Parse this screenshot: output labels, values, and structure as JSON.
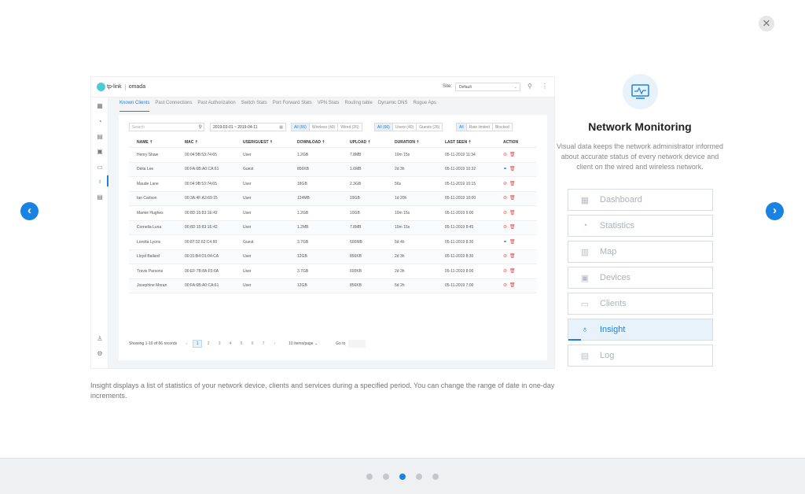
{
  "close_icon": "close-icon",
  "nav": {
    "prev_icon": "chevron-left-icon",
    "next_icon": "chevron-right-icon"
  },
  "screenshot": {
    "logo_brand": "tp-link",
    "logo_product": "omada",
    "site_label": "Site:",
    "site_value": "Default",
    "tabs": [
      "Known Clients",
      "Past Connections",
      "Past Authorization",
      "Switch Stats",
      "Port Forward Stats",
      "VPN Stats",
      "Routing table",
      "Dynamic DNS",
      "Rogue Aps"
    ],
    "search_placeholder": "Search",
    "date_range": "2019-03-01  ~  2019-04-11",
    "filter_conn": [
      "All (66)",
      "Wireless (40)",
      "Wired (26)"
    ],
    "filter_type": [
      "All (66)",
      "Users (40)",
      "Guests (26)"
    ],
    "filter_status": [
      "All",
      "Rate limited",
      "Blocked"
    ],
    "columns": [
      "NAME ⇡",
      "MAC ⇡",
      "USER/GUEST ⇡",
      "DOWNLOAD ⇡",
      "UPLOAD ⇡",
      "DURATION ⇡",
      "LAST SEEN ⇡",
      "ACTION"
    ],
    "rows": [
      {
        "name": "Henry Shaw",
        "mac": "00:04:9B:53:74:65",
        "type": "User",
        "download": "1.2GB",
        "upload": "7.8MB",
        "duration": "10m 15s",
        "last_seen": "05-11-2019 11:34"
      },
      {
        "name": "Delia Lee",
        "mac": "00:FA:6B:A0:CA:61",
        "type": "Guest",
        "download": "856KB",
        "upload": "1.6MB",
        "duration": "2d 3h",
        "last_seen": "05-11-2019 10:32"
      },
      {
        "name": "Maude Lane",
        "mac": "00:04:9B:53:74:65",
        "type": "User",
        "download": "18GB",
        "upload": "2.3GB",
        "duration": "56s",
        "last_seen": "05-11-2019 10:15"
      },
      {
        "name": "Ian Carlson",
        "mac": "00:3A:4F:A2:69:15",
        "type": "User",
        "download": "124MB",
        "upload": "19GB",
        "duration": "1d 20h",
        "last_seen": "05-11-2019 10:00"
      },
      {
        "name": "Mamie Hughes",
        "mac": "00:8D:15:83:1E:42",
        "type": "User",
        "download": "1.2GB",
        "upload": "10GB",
        "duration": "10m 15s",
        "last_seen": "05-11-2019 9:00"
      },
      {
        "name": "Cornelia Luna",
        "mac": "00:8D:15:83:1E:42",
        "type": "User",
        "download": "1.2MB",
        "upload": "7.8MB",
        "duration": "10m 15s",
        "last_seen": "05-11-2019 8:45"
      },
      {
        "name": "Loretta Lyons",
        "mac": "00:87:32:62:C4:60",
        "type": "Guest",
        "download": "3.7GB",
        "upload": "600MB",
        "duration": "5d 4h",
        "last_seen": "05-11-2019 8:30"
      },
      {
        "name": "Lloyd Ballard",
        "mac": "00:31:B4:D1:04:CA",
        "type": "User",
        "download": "12GB",
        "upload": "856KB",
        "duration": "2d 3h",
        "last_seen": "05-11-2019 8:30"
      },
      {
        "name": "Travis Parsons",
        "mac": "00:EF:7B:8A:F5:6A",
        "type": "User",
        "download": "3.7GB",
        "upload": "600KB",
        "duration": "2d 3h",
        "last_seen": "05-11-2019 8:00"
      },
      {
        "name": "Josephine Moran",
        "mac": "00:FA:6B:A0:CA:61",
        "type": "User",
        "download": "12GB",
        "upload": "856KB",
        "duration": "5d 2h",
        "last_seen": "05-11-2019 7:00"
      }
    ],
    "row_actions": [
      "block-icon",
      "delete-icon"
    ],
    "guest_actions": [
      "link-icon",
      "delete-icon"
    ],
    "pagination": {
      "info": "Showing 1-10 of 66 records",
      "prev": "‹",
      "pages": [
        "1",
        "2",
        "3",
        "4",
        "5",
        "6",
        "7"
      ],
      "next": "›",
      "page_size": "10 items/page",
      "goto_label": "Go to"
    }
  },
  "caption": "Insight displays a list of statistics of your network device, clients and services during a specified period. You can change the range of date in one-day increments.",
  "feature": {
    "icon": "monitor-icon",
    "title": "Network Monitoring",
    "description": "Visual data keeps the network administrator informed about accurate status of every network device and client on the wired and wireless network."
  },
  "menu": [
    {
      "label": "Dashboard",
      "icon": "dashboard-icon"
    },
    {
      "label": "Statistics",
      "icon": "pie-chart-icon"
    },
    {
      "label": "Map",
      "icon": "map-icon"
    },
    {
      "label": "Devices",
      "icon": "device-icon"
    },
    {
      "label": "Clients",
      "icon": "clients-icon"
    },
    {
      "label": "Insight",
      "icon": "lightbulb-icon",
      "active": true
    },
    {
      "label": "Log",
      "icon": "log-icon"
    }
  ],
  "pagination_dots": {
    "count": 5,
    "active_index": 2
  },
  "colors": {
    "accent": "#1a82e2",
    "danger": "#e94a4a",
    "logo": "#4acbd6"
  }
}
